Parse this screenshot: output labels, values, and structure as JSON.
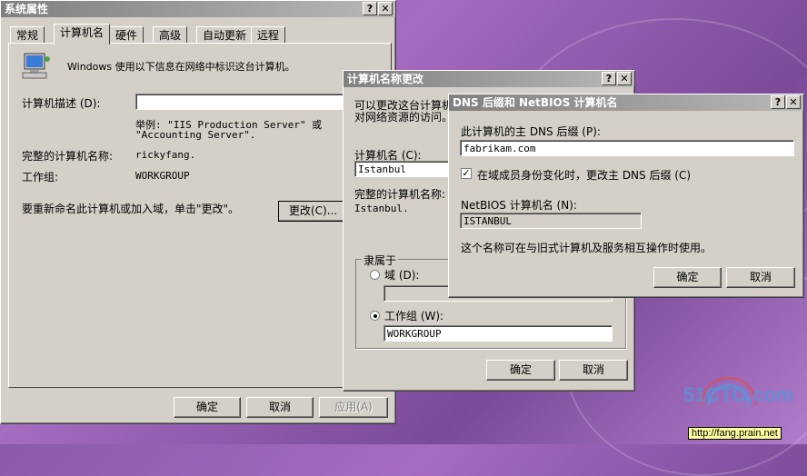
{
  "sysprops": {
    "title": "系统属性",
    "tabs": [
      "常规",
      "计算机名",
      "硬件",
      "高级",
      "自动更新",
      "远程"
    ],
    "intro": "Windows 使用以下信息在网络中标识这台计算机。",
    "desc_label": "计算机描述 (D):",
    "example_line1": "举例: \"IIS Production Server\" 或",
    "example_line2": "\"Accounting Server\".",
    "fullname_label": "完整的计算机名称:",
    "fullname_value": "rickyfang.",
    "workgroup_label": "工作组:",
    "workgroup_value": "WORKGROUP",
    "rename_text": "要重新命名此计算机或加入域，单击\"更改\"。",
    "change_button": "更改(C)...",
    "ok": "确定",
    "cancel": "取消",
    "apply": "应用(A)"
  },
  "namechange": {
    "title": "计算机名称更改",
    "intro_line1": "可以更改这台计算机",
    "intro_line2": "对网络资源的访问。",
    "name_label": "计算机名 (C):",
    "name_value": "Istanbul",
    "full_label": "完整的计算机名称:",
    "full_value": "Istanbul.",
    "member_of": "隶属于",
    "domain_label": "域 (D):",
    "domain_value": "",
    "workgroup_label": "工作组 (W):",
    "workgroup_value": "WORKGROUP",
    "ok": "确定",
    "cancel": "取消"
  },
  "dns": {
    "title": "DNS 后缀和 NetBIOS 计算机名",
    "suffix_label": "此计算机的主 DNS 后缀 (P):",
    "suffix_value": "fabrikam.com",
    "change_check_label": "在域成员身份变化时，更改主 DNS 后缀 (C)",
    "change_checked": true,
    "netbios_label": "NetBIOS 计算机名 (N):",
    "netbios_value": "ISTANBUL",
    "note": "这个名称可在与旧式计算机及服务相互操作时使用。",
    "ok": "确定",
    "cancel": "取消"
  },
  "watermark": {
    "brand": "51CTO.com",
    "blog": "http://fang.prain.net"
  }
}
